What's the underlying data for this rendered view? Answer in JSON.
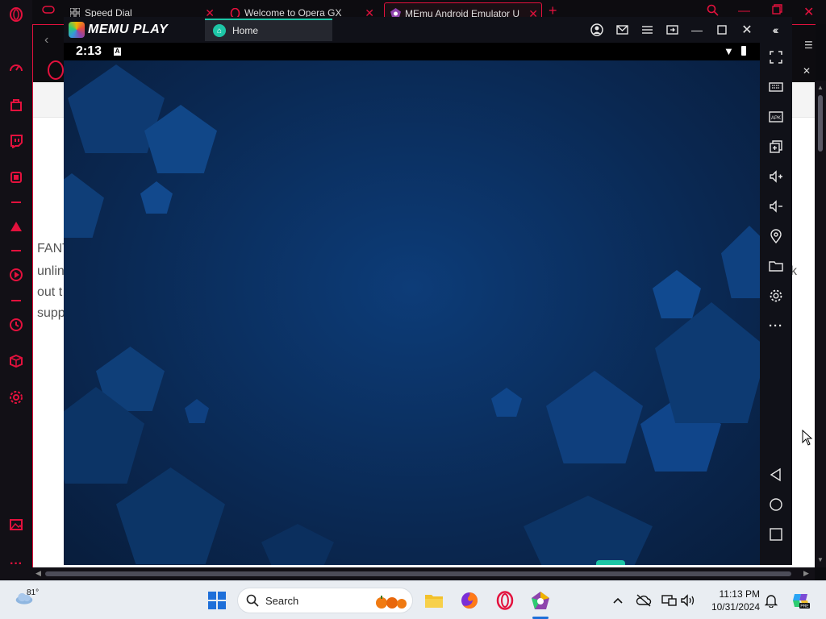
{
  "browser": {
    "tabs": [
      {
        "label": "Speed Dial",
        "icon": "grid-icon"
      },
      {
        "label": "Welcome to Opera GX",
        "icon": "opera-icon"
      },
      {
        "label": "MEmu Android Emulator U",
        "icon": "memu-icon"
      }
    ],
    "new_tab": "+",
    "page_text_lines": [
      "FANT",
      "unlin",
      "out t",
      "supp"
    ],
    "page_text_right": "k"
  },
  "memu": {
    "logo_text": "MEMU PLAY",
    "home_tab_label": "Home",
    "android": {
      "clock": "2:13",
      "status_badge": "A"
    }
  },
  "taskbar": {
    "weather_temp": "81°",
    "search_placeholder": "Search",
    "time": "11:13 PM",
    "date": "10/31/2024"
  },
  "colors": {
    "opera_accent": "#e3113d",
    "memu_accent": "#1dc6a6",
    "wallpaper": "#0b3163"
  }
}
